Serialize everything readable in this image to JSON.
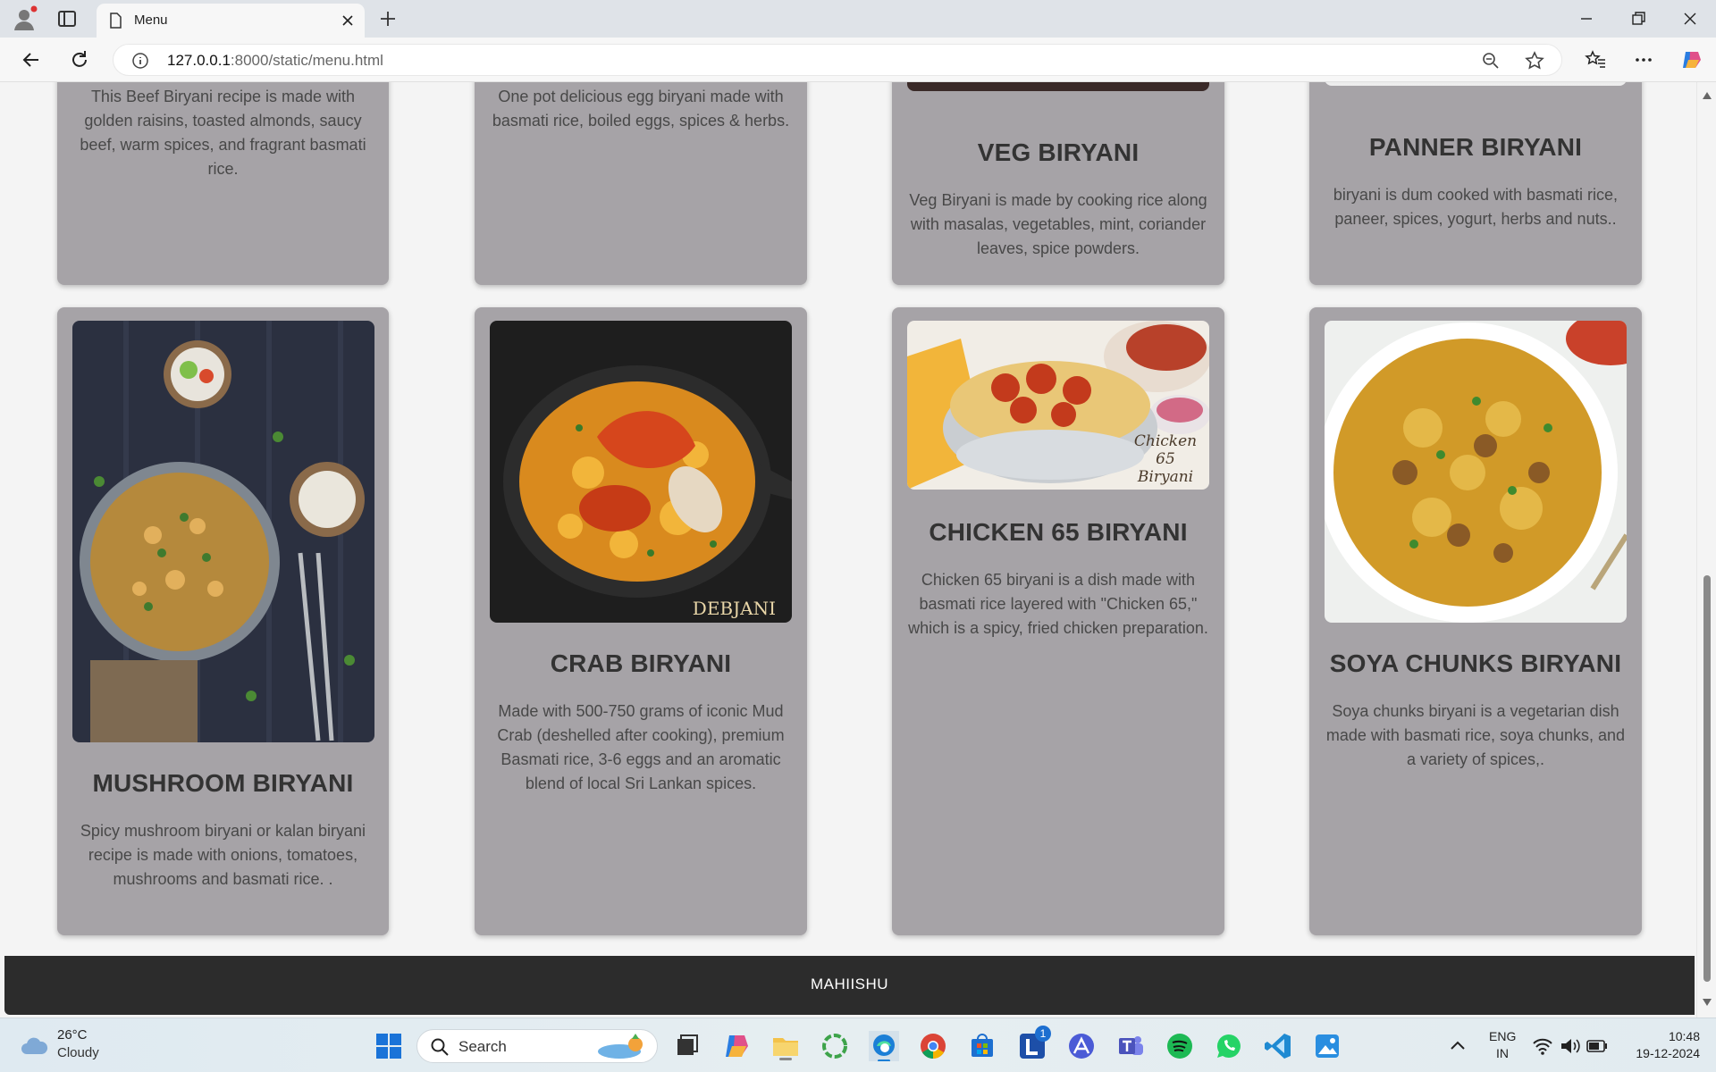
{
  "browser": {
    "tab_title": "Menu",
    "url_host": "127.0.0.1",
    "url_rest": ":8000/static/menu.html"
  },
  "menu": {
    "top_row": [
      {
        "desc": "This Beef Biryani recipe is made with golden raisins, toasted almonds, saucy beef, warm spices, and fragrant basmati rice."
      },
      {
        "desc": "One pot delicious egg biryani made with basmati rice, boiled eggs, spices & herbs."
      },
      {
        "name": "VEG BIRYANI",
        "desc": "Veg Biryani is made by cooking rice along with masalas, vegetables, mint, coriander leaves, spice powders."
      },
      {
        "name": "PANNER BIRYANI",
        "desc": "biryani is dum cooked with basmati rice, paneer, spices, yogurt, herbs and nuts.."
      }
    ],
    "bottom_row": [
      {
        "name": "MUSHROOM BIRYANI",
        "desc": "Spicy mushroom biryani or kalan biryani recipe is made with onions, tomatoes, mushrooms and basmati rice. ."
      },
      {
        "name": "CRAB BIRYANI",
        "desc": "Made with 500-750 grams of iconic Mud Crab (deshelled after cooking), premium Basmati rice, 3-6 eggs and an aromatic blend of local Sri Lankan spices.",
        "image_caption": "DEBJANI"
      },
      {
        "name": "CHICKEN 65 BIRYANI",
        "desc": "Chicken 65 biryani is a dish made with basmati rice layered with \"Chicken 65,\" which is a spicy, fried chicken preparation.",
        "image_caption": "Chicken 65 Biryani"
      },
      {
        "name": "SOYA CHUNKS BIRYANI",
        "desc": "Soya chunks biryani is a vegetarian dish made with basmati rice, soya chunks, and a variety of spices,."
      }
    ]
  },
  "footer": {
    "text": "MAHIISHU"
  },
  "taskbar": {
    "weather_temp": "26°C",
    "weather_cond": "Cloudy",
    "search_label": "Search",
    "lang_1": "ENG",
    "lang_2": "IN",
    "time": "10:48",
    "date": "19-12-2024",
    "badge": "1"
  },
  "colors": {
    "card_bg": "#a6a3a7",
    "footer_bg": "#2c2c2c",
    "page_bg": "#f4f4f4"
  }
}
